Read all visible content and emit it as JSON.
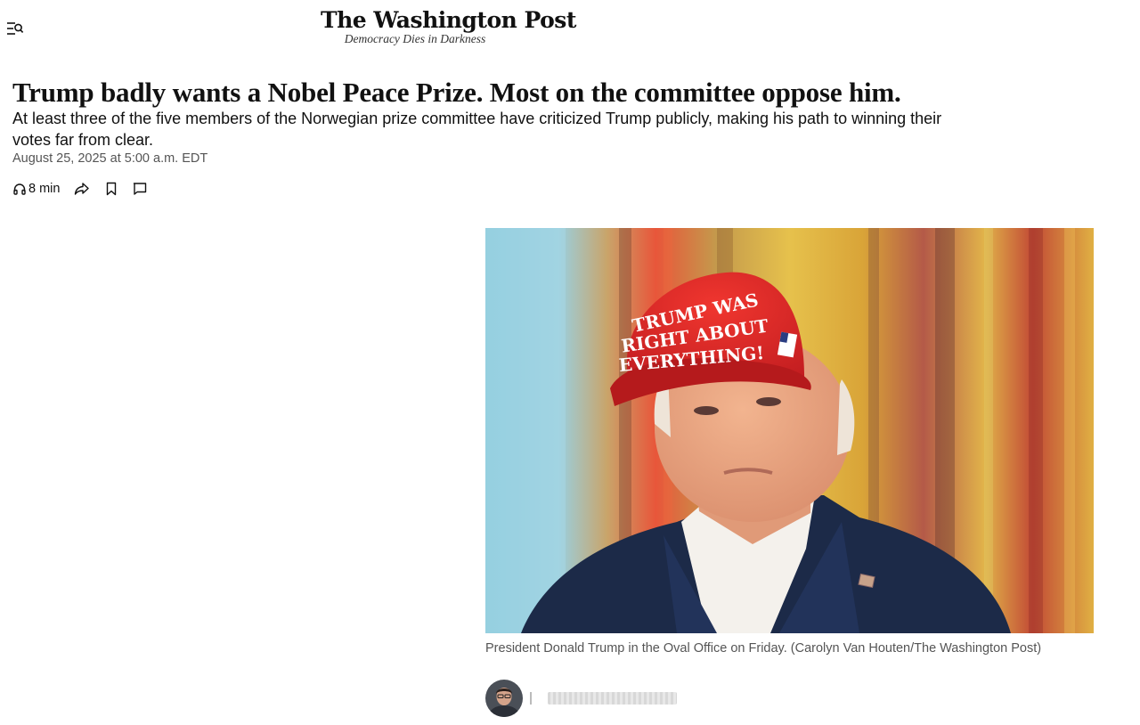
{
  "header": {
    "menu_icon": "menu-search-icon",
    "logo_text": "The Washington Post",
    "tagline": "Democracy Dies in Darkness"
  },
  "article": {
    "headline": "Trump badly wants a Nobel Peace Prize. Most on the committee oppose him.",
    "dek": "At least three of the five members of the Norwegian prize committee have criticized Trump publicly, making his path to winning their votes far from clear.",
    "dateline": "August 25, 2025 at 5:00 a.m. EDT",
    "toolbar": {
      "listen_label": "8 min",
      "icons": [
        "headphones-icon",
        "share-icon",
        "bookmark-icon",
        "comment-icon"
      ]
    },
    "photo": {
      "hat_text": [
        "TRUMP WAS",
        "RIGHT ABOUT",
        "EVERYTHING!"
      ],
      "caption": "President Donald Trump in the Oval Office on Friday. (Carolyn Van Houten/The Washington Post)"
    }
  },
  "colors": {
    "text": "#111111",
    "muted": "#555555",
    "hat_red": "#d8262b",
    "jacket_navy": "#1c2a48"
  }
}
